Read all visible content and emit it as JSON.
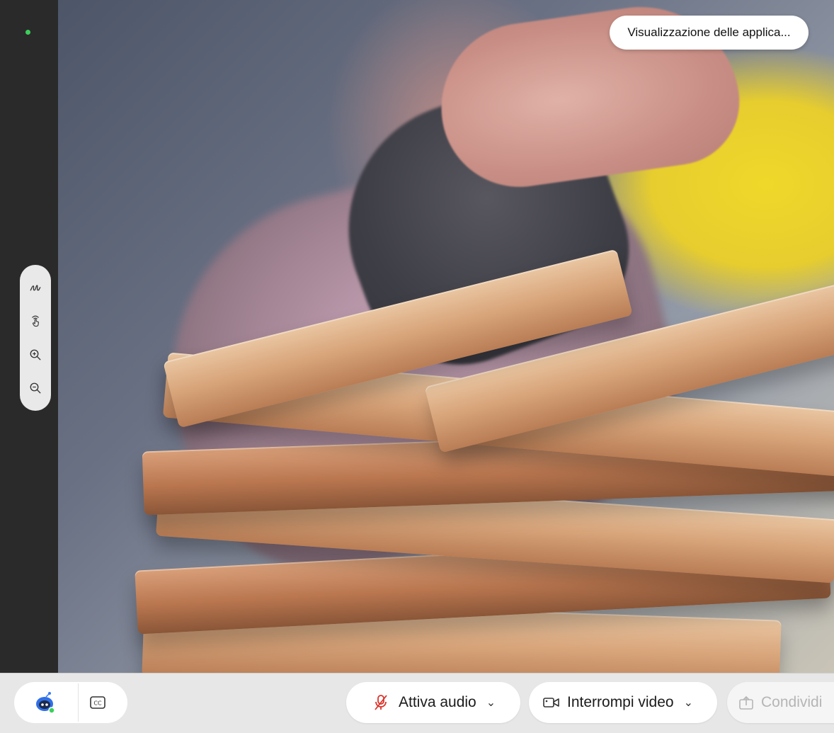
{
  "window": {
    "top_pill_text": "Visualizzazione delle applica..."
  },
  "toolbar": {
    "audio_label": "Attiva audio",
    "video_label": "Interrompi video",
    "share_label": "Condividi",
    "accent_red": "#d9342b",
    "status_green": "#3ccf5a"
  },
  "icons": {
    "annotate": "pen-squiggle-icon",
    "remote_control": "hand-pointer-icon",
    "zoom_in": "zoom-in-icon",
    "zoom_out": "zoom-out-icon",
    "assistant": "ai-assistant-bot-icon",
    "captions": "closed-captions-icon",
    "mic_muted": "mic-muted-icon",
    "camera": "video-camera-icon",
    "share": "share-icon",
    "chevron": "chevron-down-icon"
  }
}
